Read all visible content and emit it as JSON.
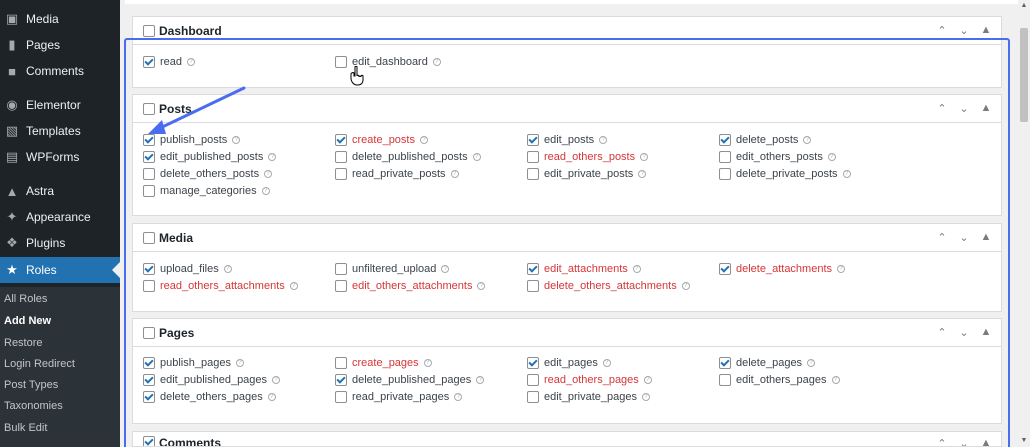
{
  "sidebar": {
    "items": [
      {
        "label": "Media",
        "icon": "media-icon"
      },
      {
        "label": "Pages",
        "icon": "pages-icon"
      },
      {
        "label": "Comments",
        "icon": "comments-icon"
      },
      {
        "label": "Elementor",
        "icon": "elementor-icon"
      },
      {
        "label": "Templates",
        "icon": "folder-icon"
      },
      {
        "label": "WPForms",
        "icon": "forms-icon"
      },
      {
        "label": "Astra",
        "icon": "astra-icon"
      },
      {
        "label": "Appearance",
        "icon": "brush-icon"
      },
      {
        "label": "Plugins",
        "icon": "plugin-icon"
      },
      {
        "label": "Roles",
        "icon": "roles-icon"
      }
    ],
    "submenu": [
      "All Roles",
      "Add New",
      "Restore",
      "Login Redirect",
      "Post Types",
      "Taxonomies",
      "Bulk Edit"
    ],
    "current_submenu": "Add New"
  },
  "panels": {
    "dashboard": {
      "title": "Dashboard",
      "caps": [
        {
          "label": "read",
          "checked": true,
          "red": false
        },
        {
          "label": "edit_dashboard",
          "checked": false,
          "red": false
        }
      ]
    },
    "posts": {
      "title": "Posts",
      "caps": [
        {
          "label": "publish_posts",
          "checked": true,
          "red": false
        },
        {
          "label": "create_posts",
          "checked": true,
          "red": true
        },
        {
          "label": "edit_posts",
          "checked": true,
          "red": false
        },
        {
          "label": "delete_posts",
          "checked": true,
          "red": false
        },
        {
          "label": "edit_published_posts",
          "checked": true,
          "red": false
        },
        {
          "label": "delete_published_posts",
          "checked": false,
          "red": false
        },
        {
          "label": "read_others_posts",
          "checked": false,
          "red": true
        },
        {
          "label": "edit_others_posts",
          "checked": false,
          "red": false
        },
        {
          "label": "delete_others_posts",
          "checked": false,
          "red": false
        },
        {
          "label": "read_private_posts",
          "checked": false,
          "red": false
        },
        {
          "label": "edit_private_posts",
          "checked": false,
          "red": false
        },
        {
          "label": "delete_private_posts",
          "checked": false,
          "red": false
        },
        {
          "label": "manage_categories",
          "checked": false,
          "red": false
        }
      ]
    },
    "media": {
      "title": "Media",
      "caps": [
        {
          "label": "upload_files",
          "checked": true,
          "red": false
        },
        {
          "label": "unfiltered_upload",
          "checked": false,
          "red": false
        },
        {
          "label": "edit_attachments",
          "checked": true,
          "red": true
        },
        {
          "label": "delete_attachments",
          "checked": true,
          "red": true
        },
        {
          "label": "read_others_attachments",
          "checked": false,
          "red": true
        },
        {
          "label": "edit_others_attachments",
          "checked": false,
          "red": true
        },
        {
          "label": "delete_others_attachments",
          "checked": false,
          "red": true
        }
      ]
    },
    "pages": {
      "title": "Pages",
      "caps": [
        {
          "label": "publish_pages",
          "checked": true,
          "red": false
        },
        {
          "label": "create_pages",
          "checked": false,
          "red": true
        },
        {
          "label": "edit_pages",
          "checked": true,
          "red": false
        },
        {
          "label": "delete_pages",
          "checked": true,
          "red": false
        },
        {
          "label": "edit_published_pages",
          "checked": true,
          "red": false
        },
        {
          "label": "delete_published_pages",
          "checked": true,
          "red": false
        },
        {
          "label": "read_others_pages",
          "checked": false,
          "red": true
        },
        {
          "label": "edit_others_pages",
          "checked": false,
          "red": false
        },
        {
          "label": "delete_others_pages",
          "checked": true,
          "red": false
        },
        {
          "label": "read_private_pages",
          "checked": false,
          "red": false
        },
        {
          "label": "edit_private_pages",
          "checked": false,
          "red": false
        }
      ]
    },
    "comments": {
      "title": "Comments"
    }
  },
  "colors": {
    "accent": "#2271b1",
    "highlight_outline": "#4a6cf0",
    "red_caps": "#d63638"
  }
}
